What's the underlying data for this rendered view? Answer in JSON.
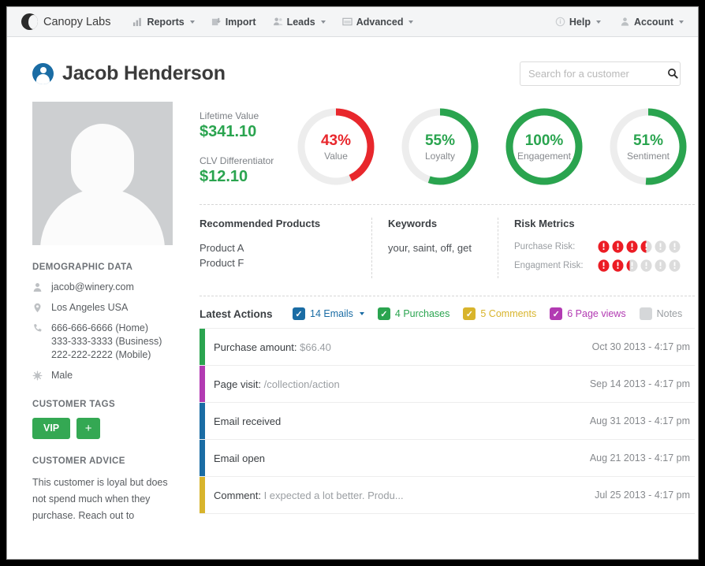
{
  "navbar": {
    "brand": "Canopy Labs",
    "items": [
      {
        "label": "Reports",
        "icon": "bar-chart-icon",
        "caret": true
      },
      {
        "label": "Import",
        "icon": "upload-icon",
        "caret": false
      },
      {
        "label": "Leads",
        "icon": "people-icon",
        "caret": true
      },
      {
        "label": "Advanced",
        "icon": "window-icon",
        "caret": true
      }
    ],
    "right": [
      {
        "label": "Help",
        "icon": "info-icon",
        "caret": true
      },
      {
        "label": "Account",
        "icon": "person-icon",
        "caret": true
      }
    ]
  },
  "header": {
    "customer_name": "Jacob Henderson",
    "search_placeholder": "Search for a customer",
    "search_value": ""
  },
  "sidebar": {
    "demographic_heading": "DEMOGRAPHIC DATA",
    "demographics": [
      {
        "icon": "person-icon",
        "lines": [
          "jacob@winery.com"
        ]
      },
      {
        "icon": "map-pin-icon",
        "lines": [
          "Los Angeles USA"
        ]
      },
      {
        "icon": "phone-icon",
        "lines": [
          "666-666-6666 (Home)",
          "333-333-3333 (Business)",
          "222-222-2222 (Mobile)"
        ]
      },
      {
        "icon": "gender-icon",
        "lines": [
          "Male"
        ]
      }
    ],
    "tags_heading": "CUSTOMER TAGS",
    "tags": [
      "VIP"
    ],
    "tag_add_label": "+",
    "advice_heading": "CUSTOMER ADVICE",
    "advice_text": "This customer is loyal but does not spend much when they purchase. Reach out to"
  },
  "metrics": {
    "lifetime_value_label": "Lifetime Value",
    "lifetime_value": "$341.10",
    "clv_diff_label": "CLV Differentiator",
    "clv_diff": "$12.10"
  },
  "chart_data": {
    "type": "pie",
    "title": "Customer scores",
    "legend_position": "center",
    "donuts": [
      {
        "label": "Value",
        "value": 43,
        "display": "43%",
        "color": "#e8272c",
        "track": "#ededed"
      },
      {
        "label": "Loyalty",
        "value": 55,
        "display": "55%",
        "color": "#2aa44f",
        "track": "#ededed"
      },
      {
        "label": "Engagement",
        "value": 100,
        "display": "100%",
        "color": "#2aa44f",
        "track": "#ededed"
      },
      {
        "label": "Sentiment",
        "value": 51,
        "display": "51%",
        "color": "#2aa44f",
        "track": "#ededed"
      }
    ]
  },
  "panels": {
    "recommended_heading": "Recommended Products",
    "recommended": [
      "Product A",
      "Product F"
    ],
    "keywords_heading": "Keywords",
    "keywords": "your, saint, off, get",
    "risk_heading": "Risk Metrics",
    "risks": [
      {
        "label": "Purchase Risk:",
        "filled": 3.5,
        "total": 6
      },
      {
        "label": "Engagment Risk:",
        "filled": 2.3,
        "total": 6
      }
    ],
    "risk_color": "#ec1c24",
    "risk_empty_color": "#dcdcdc"
  },
  "actions": {
    "title": "Latest Actions",
    "filters": [
      {
        "label": "14 Emails",
        "color": "#1a6ca4",
        "checked": true,
        "caret": true
      },
      {
        "label": "4 Purchases",
        "color": "#2aa44f",
        "checked": true,
        "caret": false
      },
      {
        "label": "5 Comments",
        "color": "#d8b42c",
        "checked": true,
        "caret": false
      },
      {
        "label": "6 Page views",
        "color": "#b23ab2",
        "checked": true,
        "caret": false
      },
      {
        "label": "Notes",
        "color": "#d5d7d9",
        "checked": false,
        "caret": false
      }
    ],
    "rows": [
      {
        "label": "Purchase amount:",
        "value": "$66.40",
        "date": "Oct 30 2013 - 4:17 pm",
        "color": "#2aa44f"
      },
      {
        "label": "Page visit:",
        "value": "/collection/action",
        "date": "Sep 14 2013 - 4:17 pm",
        "color": "#b23ab2"
      },
      {
        "label": "Email received",
        "value": "",
        "date": "Aug 31 2013 - 4:17 pm",
        "color": "#1a6ca4"
      },
      {
        "label": "Email open",
        "value": "",
        "date": "Aug 21 2013 - 4:17 pm",
        "color": "#1a6ca4"
      },
      {
        "label": "Comment:",
        "value": "I expected a lot better. Produ...",
        "date": "Jul 25 2013 - 4:17 pm",
        "color": "#d8b42c"
      }
    ]
  }
}
